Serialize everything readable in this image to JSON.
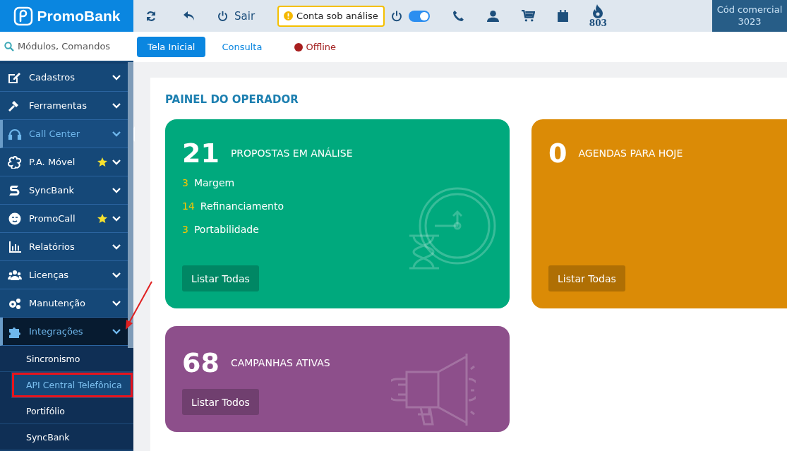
{
  "header": {
    "logo": "PromoBank",
    "sair": "Sair",
    "status_badge": "Conta sob análise",
    "online_toggle": {
      "on": true
    },
    "flame_count": "803",
    "commercial_code": {
      "label": "Cód comercial",
      "value": "3023"
    }
  },
  "search": {
    "placeholder": "Módulos, Comandos"
  },
  "tabs": [
    {
      "kind": "tab",
      "label": "Tela Inicial",
      "selected": true
    },
    {
      "kind": "tab",
      "label": "Consulta",
      "selected": false
    },
    {
      "kind": "status",
      "label": "Offline",
      "selected": false
    }
  ],
  "sidebar": {
    "items": [
      {
        "label": "Cadastros",
        "selected": false,
        "starred": false,
        "expanded": false
      },
      {
        "label": "Ferramentas",
        "selected": false,
        "starred": false,
        "expanded": false
      },
      {
        "label": "Call Center",
        "selected": true,
        "starred": false,
        "expanded": false
      },
      {
        "label": "P.A. Móvel",
        "selected": false,
        "starred": true,
        "expanded": false
      },
      {
        "label": "SyncBank",
        "selected": false,
        "starred": false,
        "expanded": false
      },
      {
        "label": "PromoCall",
        "selected": false,
        "starred": true,
        "expanded": false
      },
      {
        "label": "Relatórios",
        "selected": false,
        "starred": false,
        "expanded": false
      },
      {
        "label": "Licenças",
        "selected": false,
        "starred": false,
        "expanded": false
      },
      {
        "label": "Manutenção",
        "selected": false,
        "starred": false,
        "expanded": false
      },
      {
        "label": "Integrações",
        "selected": false,
        "starred": false,
        "expanded": true,
        "children": [
          {
            "label": "Sincronismo",
            "selected": false
          },
          {
            "label": "API Central Telefônica",
            "selected": true
          },
          {
            "label": "Portifólio",
            "selected": false
          },
          {
            "label": "SyncBank",
            "selected": false
          }
        ]
      }
    ]
  },
  "panel": {
    "title": "PAINEL DO OPERADOR",
    "cards": [
      {
        "count": "21",
        "title": "PROPOSTAS EM ANÁLISE",
        "color": "#00a97d",
        "lines": [
          {
            "count": "3",
            "label": "Margem"
          },
          {
            "count": "14",
            "label": "Refinanciamento"
          },
          {
            "count": "3",
            "label": "Portabilidade"
          }
        ],
        "button": "Listar Todas"
      },
      {
        "count": "0",
        "title": "AGENDAS PARA HOJE",
        "color": "#db8b06",
        "button": "Listar Todas"
      },
      {
        "count": "68",
        "title": "CAMPANHAS ATIVAS",
        "color": "#8d4f8b",
        "button": "Listar Todos"
      }
    ]
  }
}
